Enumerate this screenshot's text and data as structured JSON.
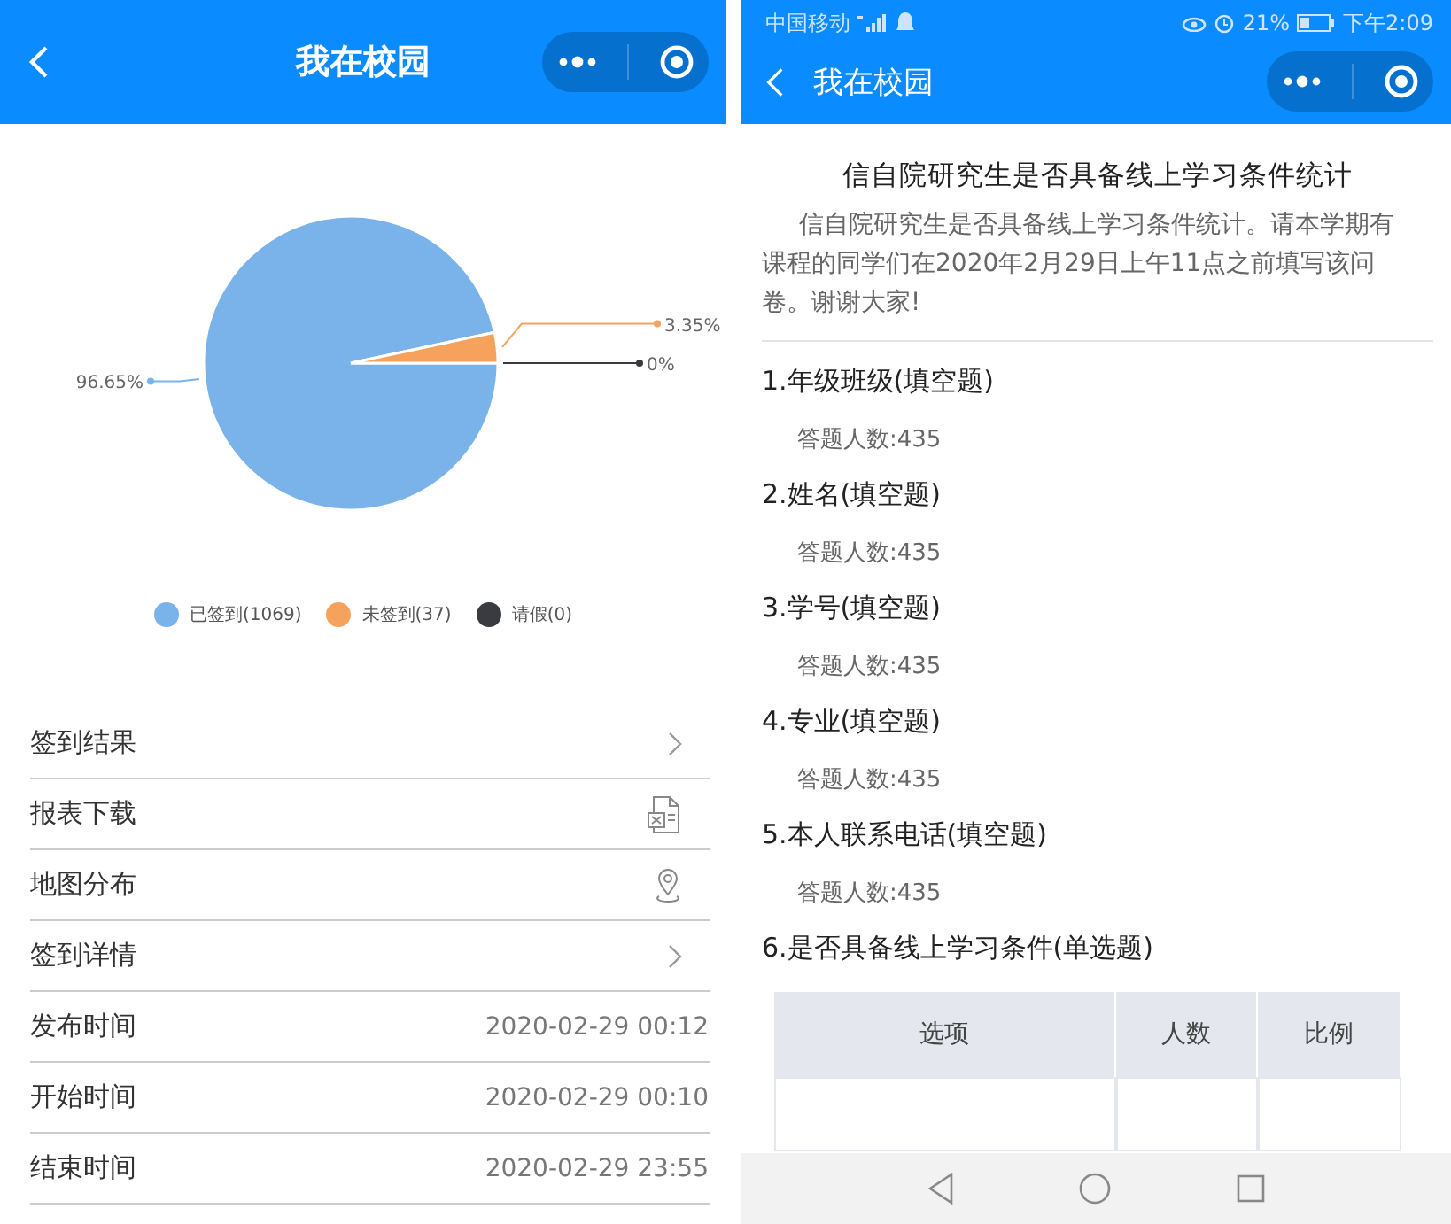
{
  "left": {
    "header": {
      "title": "我在校园"
    },
    "chart": {
      "chart_data": {
        "type": "pie",
        "categories": [
          "已签到",
          "未签到",
          "请假"
        ],
        "values": [
          96.65,
          3.35,
          0
        ],
        "value_labels": [
          "96.65%",
          "3.35%",
          "0%"
        ]
      },
      "legend": [
        {
          "count": "(1069)",
          "color": "#7ab3ea"
        },
        {
          "count": "(37)",
          "color": "#f5a35c"
        },
        {
          "count": "(0)",
          "color": "#3a3b40"
        }
      ]
    },
    "rows": [
      {
        "label": "签到结果",
        "kind": "arrow"
      },
      {
        "label": "报表下载",
        "kind": "file"
      },
      {
        "label": "地图分布",
        "kind": "pin"
      },
      {
        "label": "签到详情",
        "kind": "arrow"
      },
      {
        "label": "发布时间",
        "kind": "value",
        "value": "2020-02-29 00:12"
      },
      {
        "label": "开始时间",
        "kind": "value",
        "value": "2020-02-29 00:10"
      },
      {
        "label": "结束时间",
        "kind": "value",
        "value": "2020-02-29 23:55"
      }
    ]
  },
  "right": {
    "status_bar": {
      "carrier": "中国移动",
      "battery": "21%",
      "time": "下午2:09"
    },
    "header": {
      "title": "我在校园"
    },
    "survey": {
      "title": "信自院研究生是否具备线上学习条件统计",
      "description": "信自院研究生是否具备线上学习条件统计。请本学期有课程的同学们在2020年2月29日上午11点之前填写该问卷。谢谢大家!",
      "questions": [
        {
          "title": "1.年级班级(填空题)",
          "answers": "答题人数:435"
        },
        {
          "title": "2.姓名(填空题)",
          "answers": "答题人数:435"
        },
        {
          "title": "3.学号(填空题)",
          "answers": "答题人数:435"
        },
        {
          "title": "4.专业(填空题)",
          "answers": "答题人数:435"
        },
        {
          "title": "5.本人联系电话(填空题)",
          "answers": "答题人数:435"
        },
        {
          "title": "6.是否具备线上学习条件(单选题)",
          "table": {
            "columns": [
              "选项",
              "人数",
              "比例"
            ]
          }
        }
      ]
    }
  }
}
